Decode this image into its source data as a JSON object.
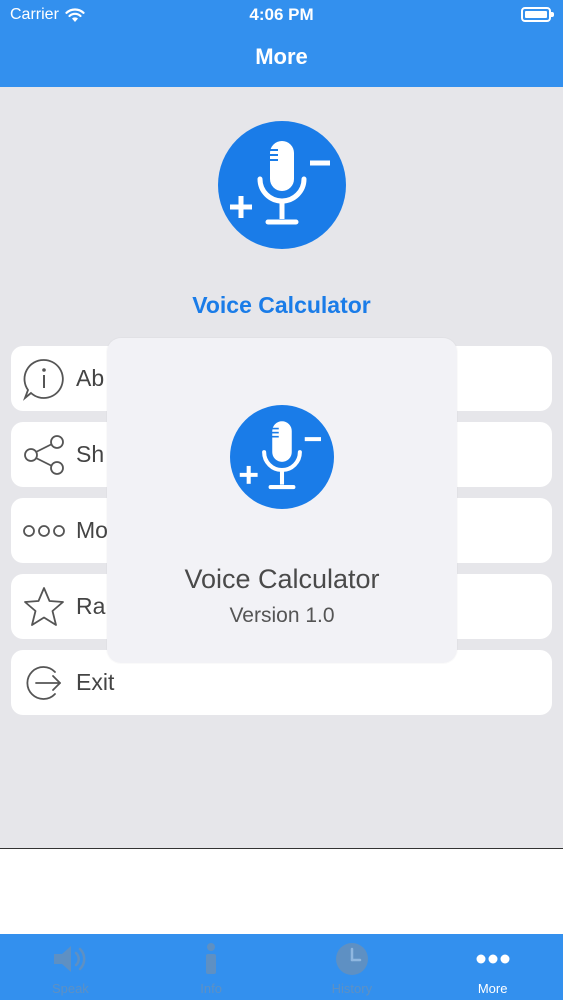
{
  "status_bar": {
    "carrier": "Carrier",
    "time": "4:06 PM"
  },
  "nav": {
    "title": "More"
  },
  "app": {
    "name": "Voice Calculator"
  },
  "menu": {
    "items": [
      {
        "label": "Ab",
        "icon": "info-circle-icon"
      },
      {
        "label": "Sh",
        "icon": "share-icon"
      },
      {
        "label": "Mo",
        "icon": "more-dots-icon"
      },
      {
        "label": "Ra",
        "icon": "star-icon"
      },
      {
        "label": "Exit",
        "icon": "exit-icon"
      }
    ]
  },
  "popup": {
    "title": "Voice Calculator",
    "version": "Version 1.0"
  },
  "tabs": [
    {
      "label": "Speak",
      "icon": "speaker-icon",
      "active": false
    },
    {
      "label": "Info",
      "icon": "info-icon",
      "active": false
    },
    {
      "label": "History",
      "icon": "clock-icon",
      "active": false
    },
    {
      "label": "More",
      "icon": "more-icon",
      "active": true
    }
  ],
  "colors": {
    "accent": "#3390ee",
    "brand_blue": "#1a7ce8",
    "background": "#e6e6ea"
  }
}
